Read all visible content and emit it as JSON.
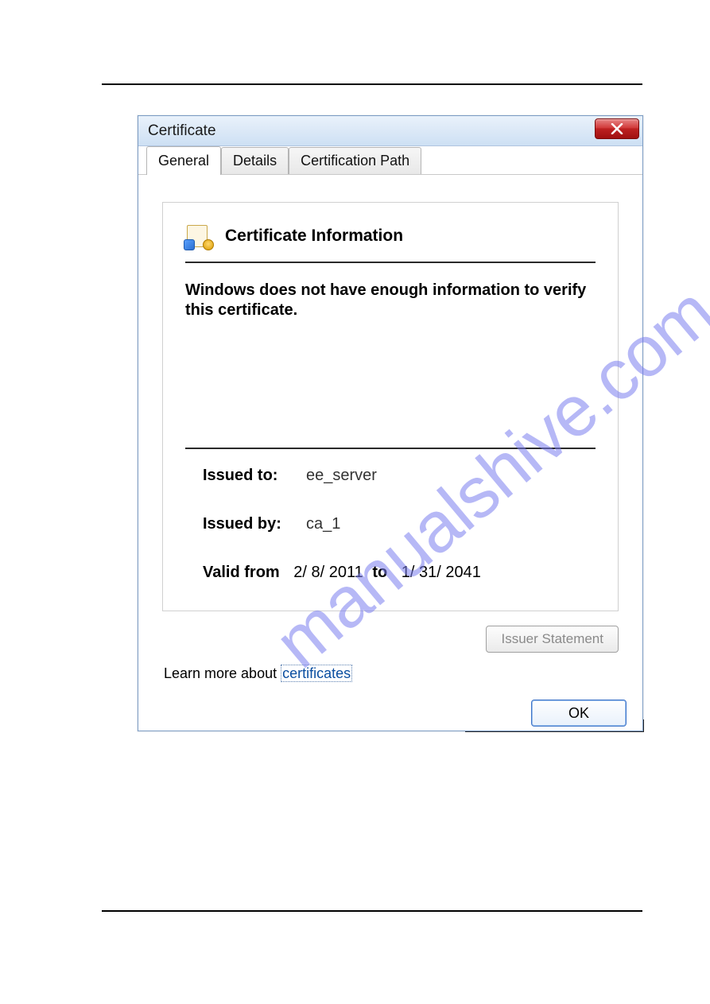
{
  "watermark": "manualshive.com",
  "dialog": {
    "title": "Certificate",
    "tabs": {
      "general": "General",
      "details": "Details",
      "certpath": "Certification Path"
    },
    "heading": "Certificate Information",
    "warning": "Windows does not have enough information to verify this certificate.",
    "fields": {
      "issued_to_label": "Issued to:",
      "issued_to_value": "ee_server",
      "issued_by_label": "Issued by:",
      "issued_by_value": "ca_1",
      "valid_from_label": "Valid from",
      "valid_from_value": "2/ 8/ 2011",
      "valid_to_label": "to",
      "valid_to_value": "1/ 31/ 2041"
    },
    "issuer_statement_btn": "Issuer Statement",
    "learn_prefix": "Learn more about ",
    "learn_link": "certificates",
    "ok_btn": "OK"
  }
}
